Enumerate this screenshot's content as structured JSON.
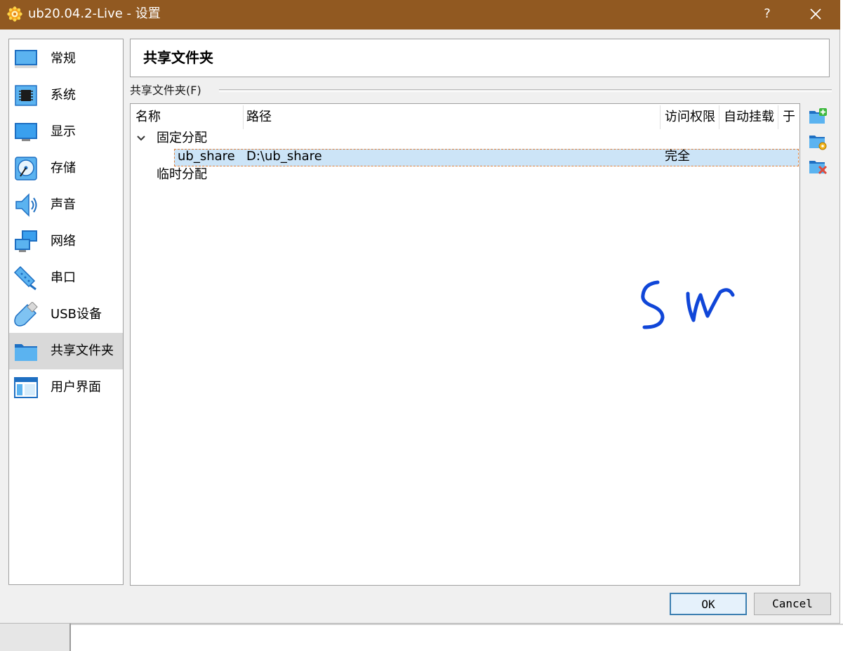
{
  "window": {
    "title": "ub20.04.2-Live - 设置",
    "help_glyph": "?",
    "titlebar_color": "#915921"
  },
  "sidebar": {
    "items": [
      {
        "label": "常规",
        "icon": "monitor-general-icon"
      },
      {
        "label": "系统",
        "icon": "chip-system-icon"
      },
      {
        "label": "显示",
        "icon": "display-monitor-icon"
      },
      {
        "label": "存储",
        "icon": "disk-storage-icon"
      },
      {
        "label": "声音",
        "icon": "speaker-audio-icon"
      },
      {
        "label": "网络",
        "icon": "network-monitors-icon"
      },
      {
        "label": "串口",
        "icon": "serial-cable-icon"
      },
      {
        "label": "USB设备",
        "icon": "usb-plug-icon"
      },
      {
        "label": "共享文件夹",
        "icon": "folder-shared-icon",
        "selected": true
      },
      {
        "label": "用户界面",
        "icon": "window-ui-icon"
      }
    ]
  },
  "page": {
    "title": "共享文件夹",
    "group_label": "共享文件夹(F)"
  },
  "table": {
    "columns": [
      "名称",
      "路径",
      "访问权限",
      "自动挂载",
      "于"
    ],
    "groups": [
      {
        "label": "固定分配",
        "rows": [
          {
            "name": "ub_share",
            "path": "D:\\ub_share",
            "access": "完全",
            "automount": "",
            "at": ""
          }
        ]
      },
      {
        "label": "临时分配",
        "rows": []
      }
    ]
  },
  "toolbar": {
    "add_icon": "folder-add-icon",
    "edit_icon": "folder-edit-icon",
    "remove_icon": "folder-remove-icon"
  },
  "buttons": {
    "ok": "OK",
    "cancel": "Cancel"
  },
  "annotation": {
    "ink_color": "#1046d8"
  }
}
